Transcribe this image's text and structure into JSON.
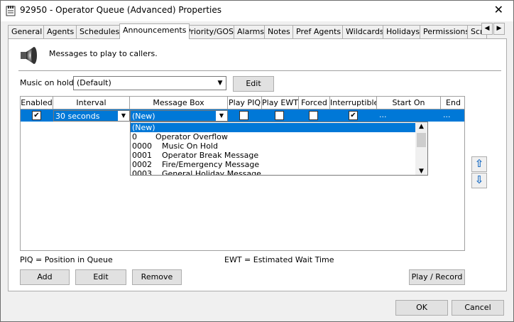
{
  "window": {
    "title": "92950 - Operator Queue (Advanced) Properties",
    "close_glyph": "✕"
  },
  "tabs": [
    {
      "label": "General"
    },
    {
      "label": "Agents"
    },
    {
      "label": "Schedules"
    },
    {
      "label": "Announcements",
      "active": true
    },
    {
      "label": "Priority/GOS"
    },
    {
      "label": "Alarms"
    },
    {
      "label": "Notes"
    },
    {
      "label": "Pref Agents"
    },
    {
      "label": "Wildcards"
    },
    {
      "label": "Holidays"
    },
    {
      "label": "Permissions"
    },
    {
      "label": "Scr"
    }
  ],
  "panel": {
    "description": "Messages to play to callers.",
    "music_on_hold_label": "Music on hold:",
    "music_on_hold_value": "(Default)",
    "edit_label": "Edit"
  },
  "grid": {
    "columns": [
      "Enabled",
      "Interval",
      "Message Box",
      "Play PIQ",
      "Play EWT",
      "Forced",
      "Interruptible",
      "Start On",
      "End"
    ],
    "row": {
      "enabled": true,
      "interval": "30 seconds",
      "message_box": "(New)",
      "play_piq": false,
      "play_ewt": false,
      "forced": false,
      "interruptible": true,
      "start_on": "...",
      "end": "..."
    },
    "dropdown_items": [
      {
        "code": "(New)",
        "name": "",
        "selected": true
      },
      {
        "code": "0",
        "name": "Operator Overflow"
      },
      {
        "code": "0000",
        "name": "Music On Hold"
      },
      {
        "code": "0001",
        "name": "Operator Break Message"
      },
      {
        "code": "0002",
        "name": "Fire/Emergency Message"
      },
      {
        "code": "0003",
        "name": "General Holiday Message"
      }
    ]
  },
  "legend": {
    "piq": "PIQ = Position in Queue",
    "ewt": "EWT = Estimated Wait Time"
  },
  "buttons": {
    "add": "Add",
    "edit": "Edit",
    "remove": "Remove",
    "play_record": "Play / Record",
    "ok": "OK",
    "cancel": "Cancel"
  },
  "colors": {
    "selection": "#0078d7",
    "accent_arrow": "#1f6fc5"
  }
}
